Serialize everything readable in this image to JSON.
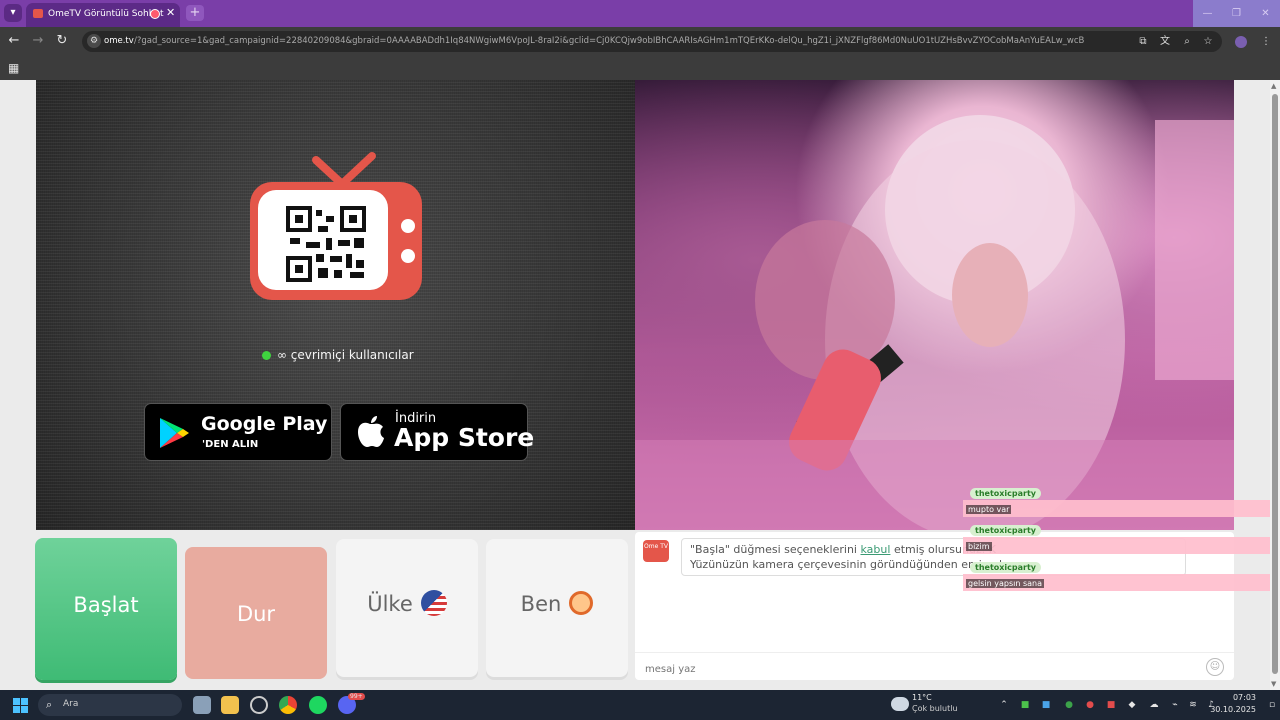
{
  "browser": {
    "tab_title": "OmeTV Görüntülü Sohbet",
    "tab_close": "✕",
    "new_tab": "+",
    "url_host": "ome.tv",
    "url_rest": "/?gad_source=1&gad_campaignid=22840209084&gbraid=0AAAABADdh1Iq84NWgiwM6VpoJL-8raI2i&gclid=Cj0KCQjw9obIBhCAARIsAGHm1mTQErKKo-delQu_hgZ1i_jXNZFlgf86Md0NuUO1tUZHsBvvZYOCobMaAnYuEALw_wcB"
  },
  "left_panel": {
    "online_text": "∞ çevrimiçi kullanıcılar",
    "google_play_title": "Google Play",
    "google_play_sub": "'DEN ALIN",
    "app_store_sub": "İndirin",
    "app_store_title": "App Store"
  },
  "controls": {
    "start": "Başlat",
    "stop": "Dur",
    "country": "Ülke",
    "me": "Ben"
  },
  "chat": {
    "logo": "Ome TV",
    "line1_pre": "\"Başla\" düğmesi seçeneklerini",
    "line1_link": "kabul",
    "line1_post": "etmiş olursunuz. K",
    "line2": "Yüzünüzün kamera çerçevesinin göründüğünden emin ol",
    "input_placeholder": "mesaj yaz"
  },
  "overlay": {
    "messages": [
      {
        "user": "thetoxicparty",
        "text": "mupto var"
      },
      {
        "user": "thetoxicparty",
        "text": "bizim"
      },
      {
        "user": "thetoxicparty",
        "text": "gelsin yapsın sana"
      }
    ]
  },
  "taskbar": {
    "search_label": "Ara",
    "weather_temp": "11°C",
    "weather_desc": "Çok bulutlu",
    "time": "07:03",
    "date": "30.10.2025",
    "discord_badge": "99+"
  },
  "colors": {
    "accent_purple": "#7a3ea8",
    "start_green": "#4fc582",
    "stop_salmon": "#e8ab9f",
    "brand_orange": "#e4564a"
  }
}
